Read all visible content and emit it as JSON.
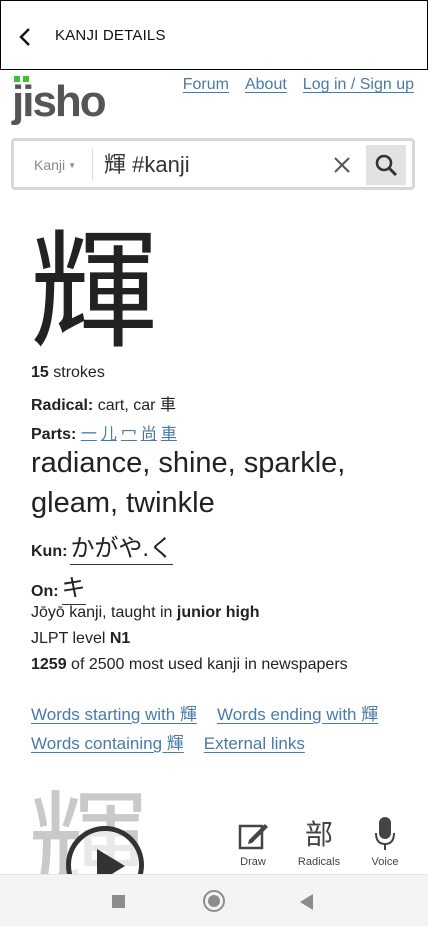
{
  "app_bar": {
    "title": "KANJI DETAILS"
  },
  "logo": {
    "text": "jisho"
  },
  "nav": {
    "forum": "Forum",
    "about": "About",
    "login": "Log in / Sign up"
  },
  "search": {
    "type_label": "Kanji",
    "query": "輝 #kanji"
  },
  "kanji": {
    "character": "輝",
    "strokes_count": "15",
    "strokes_label": "strokes",
    "radical_label": "Radical:",
    "radical_value": "cart, car 車",
    "parts_label": "Parts:",
    "parts": [
      "一",
      "儿",
      "冖",
      "尚",
      "車"
    ],
    "meaning": "radiance, shine, sparkle, gleam, twinkle",
    "kun_label": "Kun:",
    "kun_reading": "かがや.く",
    "on_label": "On:",
    "on_reading": "キ",
    "joyo_prefix": "Jōyō kanji, taught in",
    "joyo_grade": "junior high",
    "jlpt_prefix": "JLPT level",
    "jlpt_level": "N1",
    "freq_rank": "1259",
    "freq_suffix": "of 2500 most used kanji in newspapers"
  },
  "links": {
    "starting": "Words starting with 輝",
    "ending": "Words ending with 輝",
    "containing": "Words containing 輝",
    "external": "External links"
  },
  "tools": {
    "draw": "Draw",
    "radicals": "Radicals",
    "radicals_glyph": "部",
    "voice": "Voice"
  },
  "colors": {
    "link": "#4a7aa7",
    "logo_green": "#38c238",
    "logo_text": "#555555"
  }
}
